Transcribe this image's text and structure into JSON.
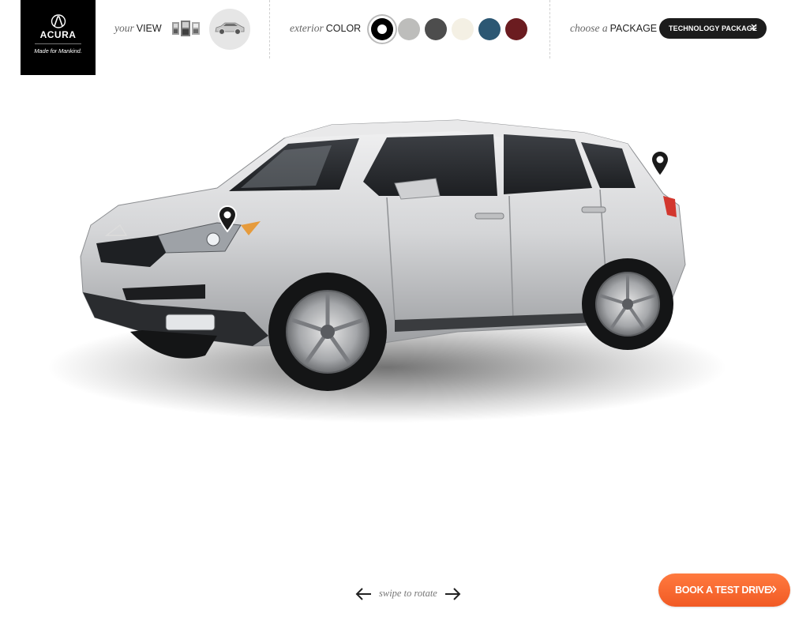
{
  "brand": {
    "name": "ACURA",
    "tagline": "Made for Mankind."
  },
  "view": {
    "label_italic": "your",
    "label_caps": "VIEW",
    "thumbs_icon": "interior-gallery-icon",
    "car_icon": "car-side-icon"
  },
  "exterior": {
    "label_italic": "exterior",
    "label_caps": "COLOR",
    "swatches": [
      {
        "color": "#000000",
        "selected": true
      },
      {
        "color": "#bdbdbb",
        "selected": false
      },
      {
        "color": "#4d4d4d",
        "selected": false
      },
      {
        "color": "#f4f0e4",
        "selected": false
      },
      {
        "color": "#2c5773",
        "selected": false
      },
      {
        "color": "#6b1c20",
        "selected": false
      }
    ]
  },
  "package": {
    "label_italic": "choose a",
    "label_caps": "PACKAGE",
    "selected": "TECHNOLOGY PACKAGE"
  },
  "vehicle": {
    "color": "#d7d8da",
    "hotspot_icon": "map-pin-icon"
  },
  "rotate": {
    "label": "swipe to rotate"
  },
  "cta": {
    "label": "BOOK A TEST DRIVE",
    "color": "#f26528"
  }
}
